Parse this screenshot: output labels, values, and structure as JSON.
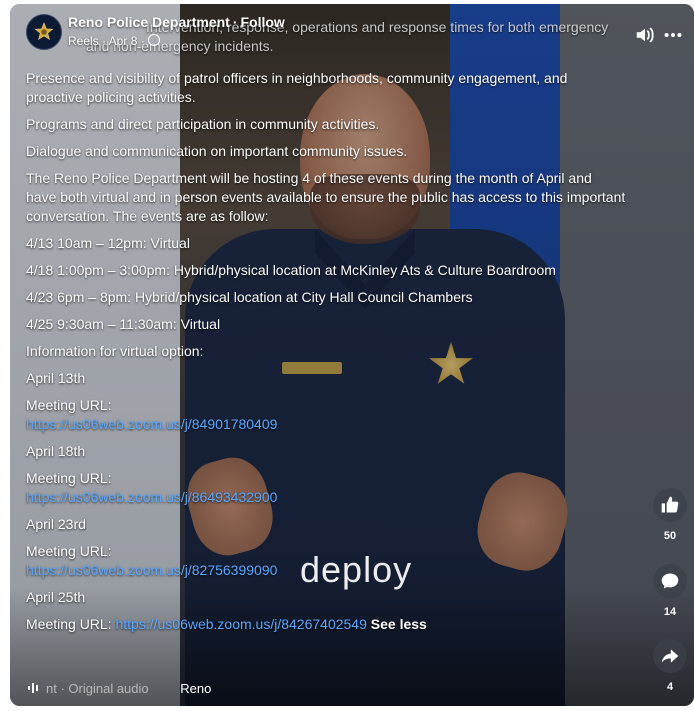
{
  "header": {
    "page_name": "Reno Police Department",
    "separator": "·",
    "follow_label": "Follow",
    "sub_label": "Reels · Apr 8 ·"
  },
  "caption": {
    "top_line_1": "Intervention, response, operations and response times for both emergency",
    "top_line_2": "and non-emergency incidents.",
    "para_patrol": "Presence and visibility of patrol officers in neighborhoods, community engagement, and proactive policing activities.",
    "para_programs": "Programs and direct participation in community activities.",
    "para_dialogue": "Dialogue and communication on important community issues.",
    "para_events": "The Reno Police Department will be hosting 4 of these events during the month of April and have both virtual and in person events available to ensure the public has access to this important conversation. The events are as follow:",
    "event_1": "4/13 10am – 12pm: Virtual",
    "event_2": "4/18 1:00pm – 3:00pm: Hybrid/physical location at McKinley Ats & Culture Boardroom",
    "event_3": "4/23 6pm – 8pm: Hybrid/physical location at City Hall Council Chambers",
    "event_4": "4/25 9:30am – 11:30am: Virtual",
    "info_virtual": "Information for virtual option:",
    "date_1": "April 13th",
    "meeting_label": "Meeting URL:",
    "url_1": "https://us06web.zoom.us/j/84901780409",
    "date_2": "April 18th",
    "url_2": "https://us06web.zoom.us/j/86493432900",
    "date_3": "April 23rd",
    "url_3": "https://us06web.zoom.us/j/82756399090",
    "date_4": "April 25th",
    "meeting_label_inline": "Meeting URL:",
    "url_4": "https://us06web.zoom.us/j/84267402549",
    "see_less": "See less"
  },
  "video": {
    "overlay_word": "deploy"
  },
  "actions": {
    "like_count": "50",
    "comment_count": "14",
    "share_count": "4"
  },
  "audio": {
    "faded_prefix": "nt",
    "label": "· Original audio",
    "name": "Reno"
  },
  "icons": {
    "avatar": "police-star-icon",
    "sound": "speaker-icon",
    "more": "more-dots-icon",
    "like": "thumbs-up-icon",
    "comment": "comment-bubble-icon",
    "share": "share-arrow-icon",
    "audio": "audio-wave-icon"
  },
  "colors": {
    "link": "#5aa7ff",
    "text": "#ffffff",
    "action_bg": "#3c4048"
  }
}
